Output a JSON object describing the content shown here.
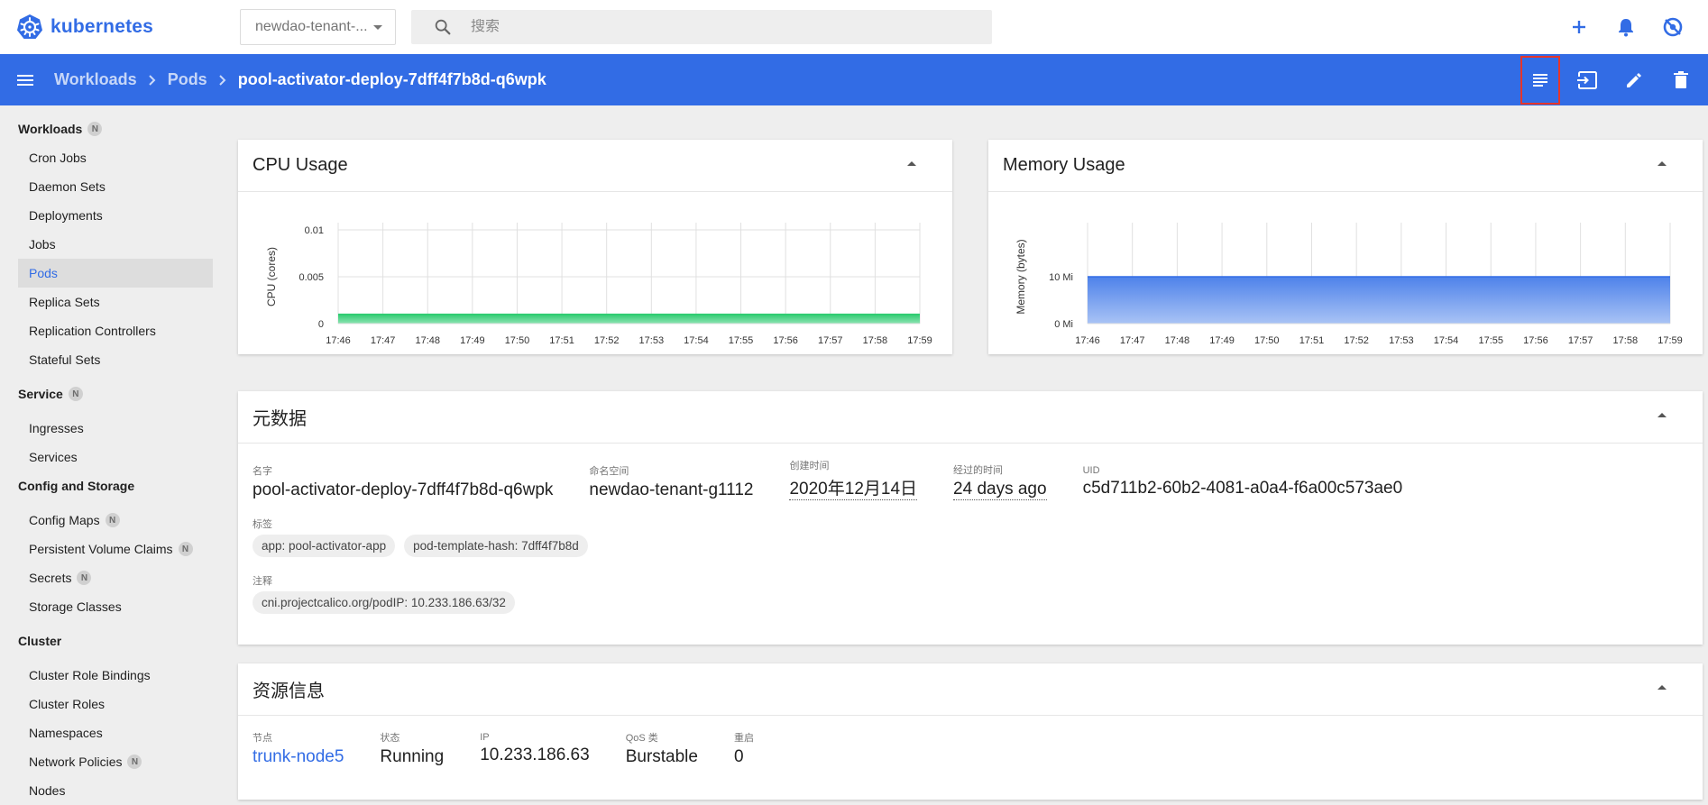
{
  "app": {
    "name": "kubernetes"
  },
  "header": {
    "namespace": "newdao-tenant-...",
    "search_placeholder": "搜索"
  },
  "toolbar": {
    "breadcrumb": [
      "Workloads",
      "Pods"
    ],
    "current": "pool-activator-deploy-7dff4f7b8d-q6wpk"
  },
  "sidebar": {
    "groups": [
      {
        "label": "Workloads",
        "badge": "N",
        "items": [
          {
            "label": "Cron Jobs"
          },
          {
            "label": "Daemon Sets"
          },
          {
            "label": "Deployments"
          },
          {
            "label": "Jobs"
          },
          {
            "label": "Pods",
            "active": true
          },
          {
            "label": "Replica Sets"
          },
          {
            "label": "Replication Controllers"
          },
          {
            "label": "Stateful Sets"
          }
        ]
      },
      {
        "label": "Service",
        "badge": "N",
        "items": [
          {
            "label": "Ingresses"
          },
          {
            "label": "Services"
          }
        ]
      },
      {
        "label": "Config and Storage",
        "badge": "",
        "items": [
          {
            "label": "Config Maps",
            "badge": "N"
          },
          {
            "label": "Persistent Volume Claims",
            "badge": "N"
          },
          {
            "label": "Secrets",
            "badge": "N"
          },
          {
            "label": "Storage Classes"
          }
        ]
      },
      {
        "label": "Cluster",
        "badge": "",
        "items": [
          {
            "label": "Cluster Role Bindings"
          },
          {
            "label": "Cluster Roles"
          },
          {
            "label": "Namespaces"
          },
          {
            "label": "Network Policies",
            "badge": "N"
          },
          {
            "label": "Nodes"
          }
        ]
      }
    ]
  },
  "cpu_card": {
    "title": "CPU Usage"
  },
  "memory_card": {
    "title": "Memory Usage"
  },
  "metadata": {
    "title": "元数据",
    "name_label": "名字",
    "name": "pool-activator-deploy-7dff4f7b8d-q6wpk",
    "namespace_label": "命名空间",
    "namespace": "newdao-tenant-g1112",
    "created_label": "创建时间",
    "created": "2020年12月14日",
    "age_label": "经过的时间",
    "age": "24 days ago",
    "uid_label": "UID",
    "uid": "c5d711b2-60b2-4081-a0a4-f6a00c573ae0",
    "labels_label": "标签",
    "labels": [
      "app: pool-activator-app",
      "pod-template-hash: 7dff4f7b8d"
    ],
    "annotations_label": "注释",
    "annotations": [
      "cni.projectcalico.org/podIP: 10.233.186.63/32"
    ]
  },
  "resource": {
    "title": "资源信息",
    "node_label": "节点",
    "node": "trunk-node5",
    "status_label": "状态",
    "status": "Running",
    "ip_label": "IP",
    "ip": "10.233.186.63",
    "qos_label": "QoS 类",
    "qos": "Burstable",
    "restarts_label": "重启",
    "restarts": "0"
  },
  "colors": {
    "brand": "#326ce5",
    "cpu_fill": "#2ecc71",
    "memory_fill": "#326ce5",
    "highlight": "#e5352a"
  },
  "chart_data": [
    {
      "type": "area",
      "title": "CPU Usage",
      "ylabel": "CPU (cores)",
      "x": [
        "17:46",
        "17:47",
        "17:48",
        "17:49",
        "17:50",
        "17:51",
        "17:52",
        "17:53",
        "17:54",
        "17:55",
        "17:56",
        "17:57",
        "17:58",
        "17:59"
      ],
      "yticks": [
        "0",
        "0.005",
        "0.01"
      ],
      "ylim": [
        0,
        0.01
      ],
      "series": [
        {
          "values": [
            0.001,
            0.001,
            0.001,
            0.001,
            0.001,
            0.001,
            0.001,
            0.001,
            0.001,
            0.001,
            0.001,
            0.001,
            0.001,
            0.001
          ]
        }
      ],
      "grid": true
    },
    {
      "type": "area",
      "title": "Memory Usage",
      "ylabel": "Memory (bytes)",
      "x": [
        "17:46",
        "17:47",
        "17:48",
        "17:49",
        "17:50",
        "17:51",
        "17:52",
        "17:53",
        "17:54",
        "17:55",
        "17:56",
        "17:57",
        "17:58",
        "17:59"
      ],
      "yticks": [
        "0 Mi",
        "10 Mi"
      ],
      "ylim": [
        0,
        20
      ],
      "series": [
        {
          "values": [
            10,
            10,
            10,
            10,
            10,
            10,
            10,
            10,
            10,
            10,
            10,
            10,
            10,
            10
          ]
        }
      ],
      "grid": true
    }
  ]
}
